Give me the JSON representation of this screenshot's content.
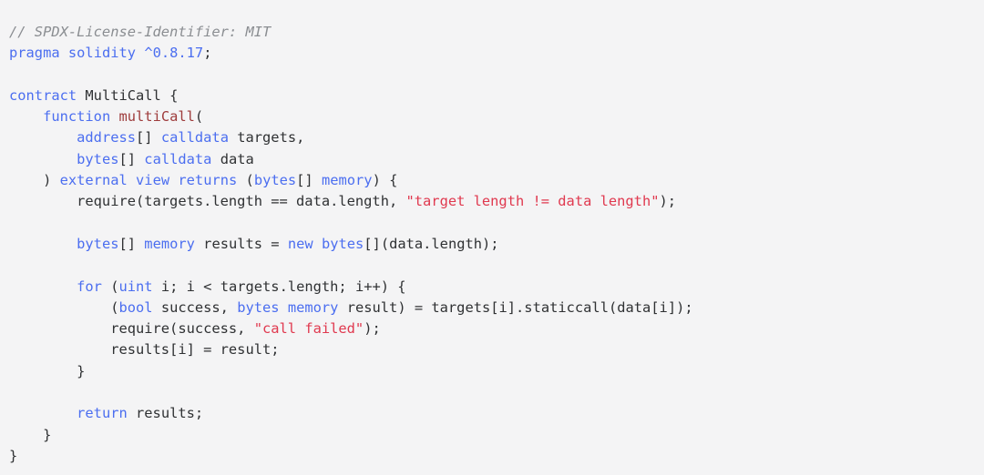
{
  "editor": {
    "language": "solidity",
    "background_color": "#f4f4f5",
    "font_size_px": 15.4,
    "line_height_px": 23.3,
    "theme_colors": {
      "plain": "#2f3133",
      "keyword": "#4b6ef0",
      "type": "#4b6ef0",
      "function": "#9e3b3b",
      "string": "#e0394f",
      "comment": "#8a8d91"
    }
  },
  "code": {
    "plain_text": "// SPDX-License-Identifier: MIT\npragma solidity ^0.8.17;\n\ncontract MultiCall {\n    function multiCall(\n        address[] calldata targets,\n        bytes[] calldata data\n    ) external view returns (bytes[] memory) {\n        require(targets.length == data.length, \"target length != data length\");\n\n        bytes[] memory results = new bytes[](data.length);\n\n        for (uint i; i < targets.length; i++) {\n            (bool success, bytes memory result) = targets[i].staticcall(data[i]);\n            require(success, \"call failed\");\n            results[i] = result;\n        }\n\n        return results;\n    }\n}",
    "lines": [
      {
        "n": 1,
        "tokens": [
          {
            "t": "// SPDX-License-Identifier: MIT",
            "c": "comment"
          }
        ]
      },
      {
        "n": 2,
        "tokens": [
          {
            "t": "pragma",
            "c": "keyword"
          },
          {
            "t": " ",
            "c": "plain"
          },
          {
            "t": "solidity",
            "c": "keyword"
          },
          {
            "t": " ",
            "c": "plain"
          },
          {
            "t": "^0.8.17",
            "c": "number"
          },
          {
            "t": ";",
            "c": "punct"
          }
        ]
      },
      {
        "n": 3,
        "tokens": []
      },
      {
        "n": 4,
        "tokens": [
          {
            "t": "contract",
            "c": "keyword"
          },
          {
            "t": " MultiCall {",
            "c": "plain"
          }
        ]
      },
      {
        "n": 5,
        "tokens": [
          {
            "t": "    ",
            "c": "plain"
          },
          {
            "t": "function",
            "c": "keyword"
          },
          {
            "t": " ",
            "c": "plain"
          },
          {
            "t": "multiCall",
            "c": "func"
          },
          {
            "t": "(",
            "c": "punct"
          }
        ]
      },
      {
        "n": 6,
        "tokens": [
          {
            "t": "        ",
            "c": "plain"
          },
          {
            "t": "address",
            "c": "type"
          },
          {
            "t": "[] ",
            "c": "punct"
          },
          {
            "t": "calldata",
            "c": "keyword"
          },
          {
            "t": " targets,",
            "c": "plain"
          }
        ]
      },
      {
        "n": 7,
        "tokens": [
          {
            "t": "        ",
            "c": "plain"
          },
          {
            "t": "bytes",
            "c": "type"
          },
          {
            "t": "[] ",
            "c": "punct"
          },
          {
            "t": "calldata",
            "c": "keyword"
          },
          {
            "t": " data",
            "c": "plain"
          }
        ]
      },
      {
        "n": 8,
        "tokens": [
          {
            "t": "    ) ",
            "c": "punct"
          },
          {
            "t": "external",
            "c": "keyword"
          },
          {
            "t": " ",
            "c": "plain"
          },
          {
            "t": "view",
            "c": "keyword"
          },
          {
            "t": " ",
            "c": "plain"
          },
          {
            "t": "returns",
            "c": "keyword"
          },
          {
            "t": " (",
            "c": "punct"
          },
          {
            "t": "bytes",
            "c": "type"
          },
          {
            "t": "[] ",
            "c": "punct"
          },
          {
            "t": "memory",
            "c": "keyword"
          },
          {
            "t": ") {",
            "c": "punct"
          }
        ]
      },
      {
        "n": 9,
        "tokens": [
          {
            "t": "        require(targets.length == data.length, ",
            "c": "plain"
          },
          {
            "t": "\"target length != data length\"",
            "c": "string"
          },
          {
            "t": ");",
            "c": "plain"
          }
        ]
      },
      {
        "n": 10,
        "tokens": []
      },
      {
        "n": 11,
        "tokens": [
          {
            "t": "        ",
            "c": "plain"
          },
          {
            "t": "bytes",
            "c": "type"
          },
          {
            "t": "[] ",
            "c": "punct"
          },
          {
            "t": "memory",
            "c": "keyword"
          },
          {
            "t": " results = ",
            "c": "plain"
          },
          {
            "t": "new",
            "c": "keyword"
          },
          {
            "t": " ",
            "c": "plain"
          },
          {
            "t": "bytes",
            "c": "type"
          },
          {
            "t": "[](data.length);",
            "c": "plain"
          }
        ]
      },
      {
        "n": 12,
        "tokens": []
      },
      {
        "n": 13,
        "tokens": [
          {
            "t": "        ",
            "c": "plain"
          },
          {
            "t": "for",
            "c": "keyword"
          },
          {
            "t": " (",
            "c": "punct"
          },
          {
            "t": "uint",
            "c": "type"
          },
          {
            "t": " i; i < targets.length; i++) {",
            "c": "plain"
          }
        ]
      },
      {
        "n": 14,
        "tokens": [
          {
            "t": "            (",
            "c": "punct"
          },
          {
            "t": "bool",
            "c": "type"
          },
          {
            "t": " success, ",
            "c": "plain"
          },
          {
            "t": "bytes",
            "c": "type"
          },
          {
            "t": " ",
            "c": "plain"
          },
          {
            "t": "memory",
            "c": "keyword"
          },
          {
            "t": " result) = targets[i].staticcall(data[i]);",
            "c": "plain"
          }
        ]
      },
      {
        "n": 15,
        "tokens": [
          {
            "t": "            require(success, ",
            "c": "plain"
          },
          {
            "t": "\"call failed\"",
            "c": "string"
          },
          {
            "t": ");",
            "c": "plain"
          }
        ]
      },
      {
        "n": 16,
        "tokens": [
          {
            "t": "            results[i] = result;",
            "c": "plain"
          }
        ]
      },
      {
        "n": 17,
        "tokens": [
          {
            "t": "        }",
            "c": "plain"
          }
        ]
      },
      {
        "n": 18,
        "tokens": []
      },
      {
        "n": 19,
        "tokens": [
          {
            "t": "        ",
            "c": "plain"
          },
          {
            "t": "return",
            "c": "keyword"
          },
          {
            "t": " results;",
            "c": "plain"
          }
        ]
      },
      {
        "n": 20,
        "tokens": [
          {
            "t": "    }",
            "c": "plain"
          }
        ]
      },
      {
        "n": 21,
        "tokens": [
          {
            "t": "}",
            "c": "plain"
          }
        ]
      }
    ]
  }
}
